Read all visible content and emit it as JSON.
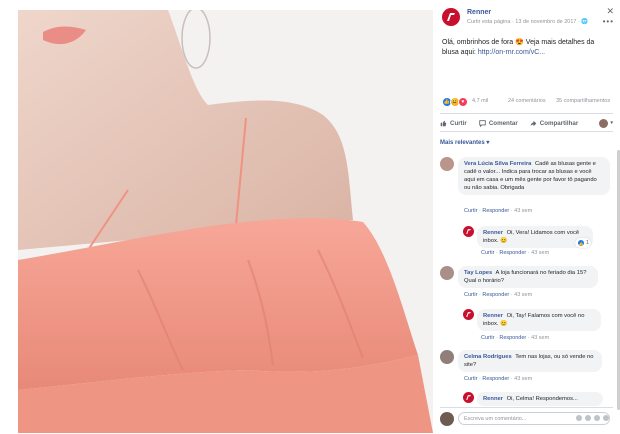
{
  "post": {
    "page_name": "Renner",
    "meta": "Curtir esta página · 13 de novembro de 2017 · 🌐",
    "text": "Olá, ombrinhos de fora 😍 Veja mais detalhes da blusa aqui:",
    "link": "http://on-rnr.com/vC..."
  },
  "stats": {
    "reactions": "4,7 mil",
    "comments": "24 comentários",
    "shares": "35 compartilhamentos"
  },
  "actions": {
    "like": "Curtir",
    "comment": "Comentar",
    "share": "Compartilhar"
  },
  "sort_label": "Mais relevantes ▾",
  "comments": [
    {
      "author": "Vera Lúcia Silva Ferreira",
      "text": "Cadê as blusas gente e cadê o valor... Indica para trocar as blusas e você aqui em casa e um mês gente por favor tô pagando ou não sabia. Obrigada",
      "like": "Curtir",
      "reply": "Responder",
      "time": "43 sem"
    },
    {
      "author": "Renner",
      "text": "Oi, Vera! Lidamos com você inbox. 😊",
      "like": "Curtir",
      "reply": "Responder",
      "time": "43 sem",
      "reactions": "1"
    },
    {
      "author": "Tay Lopes",
      "text": "A loja funcionará no feriado dia 15? Qual o horário?",
      "like": "Curtir",
      "reply": "Responder",
      "time": "43 sem"
    },
    {
      "author": "Renner",
      "text": "Oi, Tay! Falamos com você no inbox. 😊",
      "like": "Curtir",
      "reply": "Responder",
      "time": "43 sem"
    },
    {
      "author": "Celma Rodrigues",
      "text": "Tem nas lojas, ou só vende no site?",
      "like": "Curtir",
      "reply": "Responder",
      "time": "43 sem"
    },
    {
      "author": "Renner",
      "text": "Oi, Celma! Respondemos..."
    }
  ],
  "composer": {
    "placeholder": "Escreva um comentário..."
  },
  "colors": {
    "brand": "#c8102e",
    "link": "#385898",
    "blouse": "#f39a8c",
    "skin": "#eacfc4"
  }
}
